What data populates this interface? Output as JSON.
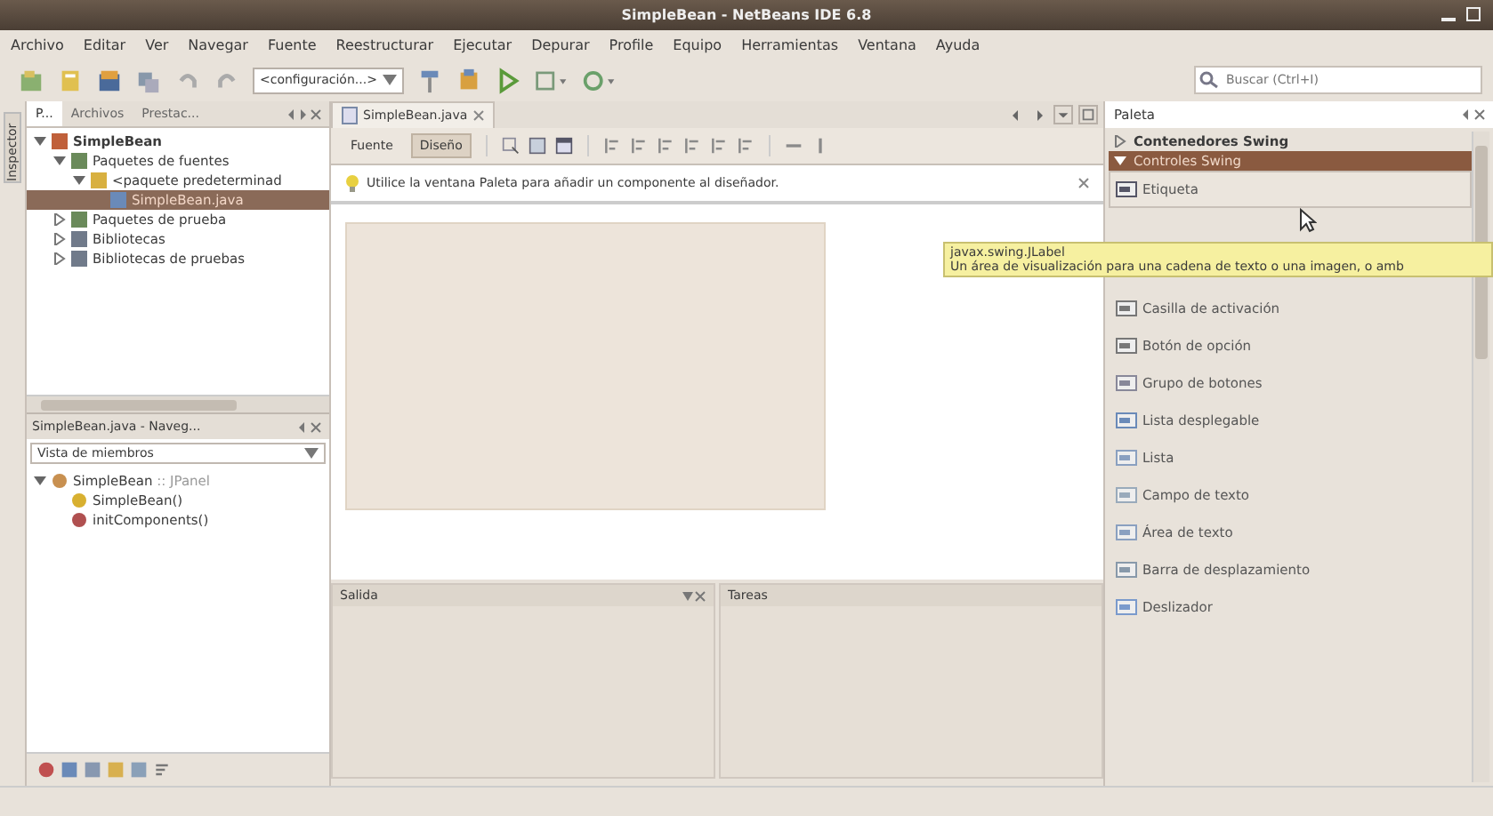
{
  "window": {
    "title": "SimpleBean - NetBeans IDE 6.8"
  },
  "menu": [
    "Archivo",
    "Editar",
    "Ver",
    "Navegar",
    "Fuente",
    "Reestructurar",
    "Ejecutar",
    "Depurar",
    "Profile",
    "Equipo",
    "Herramientas",
    "Ventana",
    "Ayuda"
  ],
  "toolbar": {
    "configuration": "<configuración...>",
    "search": {
      "placeholder": "Buscar (Ctrl+I)"
    }
  },
  "side_strip": {
    "label": "Inspector"
  },
  "projects_panel": {
    "tabs": [
      {
        "label": "P...",
        "selected": true
      },
      {
        "label": "Archivos",
        "selected": false
      },
      {
        "label": "Prestac...",
        "selected": false
      }
    ],
    "tree": [
      {
        "label": "SimpleBean",
        "kind": "project",
        "bold": true,
        "expanded": true,
        "selected": false,
        "children": [
          {
            "label": "Paquetes de fuentes",
            "kind": "sources",
            "expanded": true,
            "selected": false,
            "children": [
              {
                "label": "<paquete predeterminad",
                "kind": "package",
                "expanded": true,
                "selected": false,
                "children": [
                  {
                    "label": "SimpleBean.java",
                    "kind": "java",
                    "selected": true
                  }
                ]
              }
            ]
          },
          {
            "label": "Paquetes de prueba",
            "kind": "sources",
            "expanded": false,
            "selected": false
          },
          {
            "label": "Bibliotecas",
            "kind": "library",
            "expanded": false,
            "selected": false
          },
          {
            "label": "Bibliotecas de pruebas",
            "kind": "library",
            "expanded": false,
            "selected": false
          }
        ]
      }
    ]
  },
  "navigator": {
    "title": "SimpleBean.java - Naveg...",
    "filter": "Vista de miembros",
    "tree": [
      {
        "label": "SimpleBean",
        "suffix": " :: JPanel",
        "kind": "class",
        "expanded": true,
        "selected": false,
        "children": [
          {
            "label": "SimpleBean()",
            "kind": "constructor",
            "selected": false
          },
          {
            "label": "initComponents()",
            "kind": "method",
            "selected": false
          }
        ]
      }
    ]
  },
  "editor": {
    "tab": "SimpleBean.java",
    "views": [
      {
        "label": "Fuente",
        "selected": false
      },
      {
        "label": "Diseño",
        "selected": true
      }
    ],
    "hint": "Utilice la ventana Paleta para añadir un componente al diseñador."
  },
  "tooltip": {
    "title": "javax.swing.JLabel",
    "text": "Un área de visualización para una cadena de texto o una imagen, o amb"
  },
  "palette": {
    "title": "Paleta",
    "categories": [
      {
        "label": "Contenedores Swing",
        "expanded": false,
        "selected": false
      },
      {
        "label": "Controles Swing",
        "expanded": true,
        "selected": true
      }
    ],
    "items": [
      {
        "label": "Etiqueta",
        "kind": "label",
        "selected": true
      },
      {
        "label": "Casilla de activación",
        "kind": "check",
        "selected": false
      },
      {
        "label": "Botón de opción",
        "kind": "radio",
        "selected": false
      },
      {
        "label": "Grupo de botones",
        "kind": "group",
        "selected": false
      },
      {
        "label": "Lista desplegable",
        "kind": "combo",
        "selected": false
      },
      {
        "label": "Lista",
        "kind": "list",
        "selected": false
      },
      {
        "label": "Campo de texto",
        "kind": "field",
        "selected": false
      },
      {
        "label": "Área de texto",
        "kind": "area",
        "selected": false
      },
      {
        "label": "Barra de desplazamiento",
        "kind": "scroll",
        "selected": false
      },
      {
        "label": "Deslizador",
        "kind": "slider",
        "selected": false
      }
    ]
  },
  "bottom_panels": [
    {
      "label": "Salida"
    },
    {
      "label": "Tareas"
    }
  ]
}
